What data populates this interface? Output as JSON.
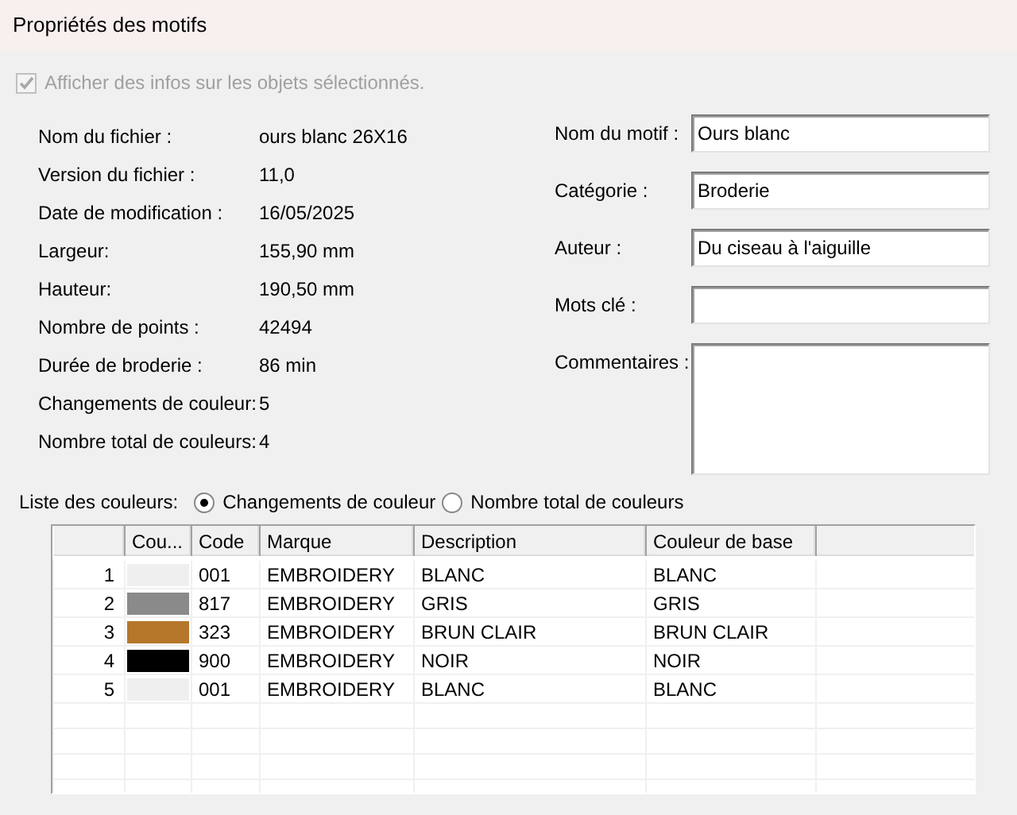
{
  "window": {
    "title": "Propriétés des motifs"
  },
  "show_info": {
    "label": "Afficher des infos sur les objets sélectionnés.",
    "checked": true,
    "disabled": true
  },
  "info": [
    {
      "label": "Nom du fichier :",
      "value": "ours blanc 26X16"
    },
    {
      "label": "Version du fichier :",
      "value": "11,0"
    },
    {
      "label": "Date de modification :",
      "value": "16/05/2025"
    },
    {
      "label": "Largeur:",
      "value": "155,90 mm"
    },
    {
      "label": "Hauteur:",
      "value": "190,50 mm"
    },
    {
      "label": "Nombre de points :",
      "value": "42494"
    },
    {
      "label": "Durée de broderie :",
      "value": "86 min"
    },
    {
      "label": "Changements de couleur:",
      "value": "5"
    },
    {
      "label": "Nombre total de couleurs:",
      "value": "4"
    }
  ],
  "fields": [
    {
      "label": "Nom du motif :",
      "value": "Ours blanc",
      "kind": "line"
    },
    {
      "label": "Catégorie :",
      "value": "Broderie",
      "kind": "line"
    },
    {
      "label": "Auteur :",
      "value": "Du ciseau à l'aiguille",
      "kind": "line"
    },
    {
      "label": "Mots clé :",
      "kind": "line"
    },
    {
      "label": "Commentaires :",
      "kind": "multiline"
    }
  ],
  "color_list": {
    "label": "Liste des couleurs:",
    "options": [
      {
        "label": "Changements de couleur",
        "selected": true
      },
      {
        "label": "Nombre total de couleurs",
        "selected": false
      }
    ]
  },
  "table": {
    "columns": [
      "Cou...",
      "Code",
      "Marque",
      "Description",
      "Couleur de base"
    ],
    "rows": [
      {
        "index": "1",
        "color": "#efefef",
        "code": "001",
        "brand": "EMBROIDERY",
        "description": "BLANC",
        "base": "BLANC"
      },
      {
        "index": "2",
        "color": "#8a8a8a",
        "code": "817",
        "brand": "EMBROIDERY",
        "description": "GRIS",
        "base": "GRIS"
      },
      {
        "index": "3",
        "color": "#b5772a",
        "code": "323",
        "brand": "EMBROIDERY",
        "description": "BRUN CLAIR",
        "base": "BRUN CLAIR"
      },
      {
        "index": "4",
        "color": "#000000",
        "code": "900",
        "brand": "EMBROIDERY",
        "description": "NOIR",
        "base": "NOIR"
      },
      {
        "index": "5",
        "color": "#efefef",
        "code": "001",
        "brand": "EMBROIDERY",
        "description": "BLANC",
        "base": "BLANC"
      }
    ]
  }
}
